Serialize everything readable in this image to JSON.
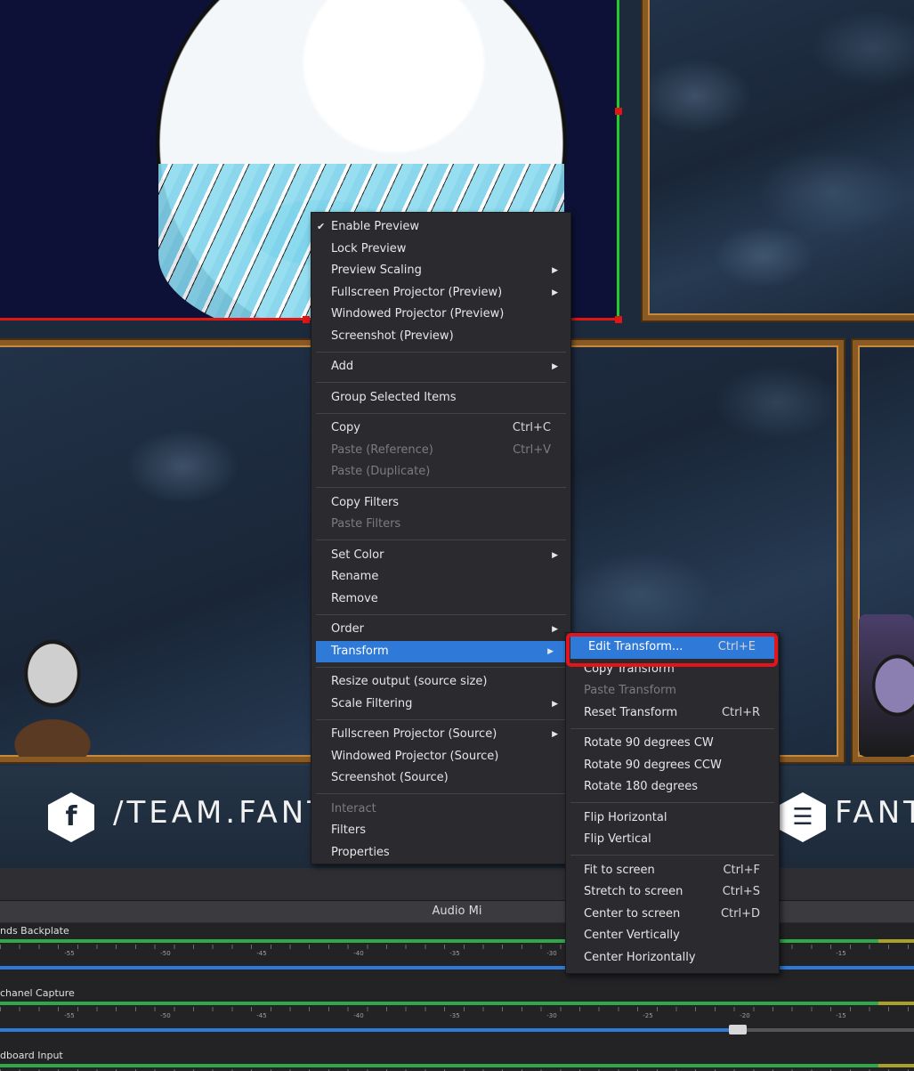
{
  "canvas": {
    "banner_left_text": "/TEAM.FANTA",
    "banner_right_text": "FANTA",
    "facebook_glyph": "f"
  },
  "context_menu": {
    "items": [
      {
        "label": "Enable Preview",
        "checked": true
      },
      {
        "label": "Lock Preview"
      },
      {
        "label": "Preview Scaling",
        "submenu": true
      },
      {
        "label": "Fullscreen Projector (Preview)",
        "submenu": true
      },
      {
        "label": "Windowed Projector (Preview)"
      },
      {
        "label": "Screenshot (Preview)"
      },
      {
        "label": "Add",
        "submenu": true
      },
      {
        "label": "Group Selected Items"
      },
      {
        "label": "Copy",
        "shortcut": "Ctrl+C"
      },
      {
        "label": "Paste (Reference)",
        "shortcut": "Ctrl+V",
        "disabled": true
      },
      {
        "label": "Paste (Duplicate)",
        "disabled": true
      },
      {
        "label": "Copy Filters"
      },
      {
        "label": "Paste Filters",
        "disabled": true
      },
      {
        "label": "Set Color",
        "submenu": true
      },
      {
        "label": "Rename"
      },
      {
        "label": "Remove"
      },
      {
        "label": "Order",
        "submenu": true
      },
      {
        "label": "Transform",
        "submenu": true,
        "active": true
      },
      {
        "label": "Resize output (source size)"
      },
      {
        "label": "Scale Filtering",
        "submenu": true
      },
      {
        "label": "Fullscreen Projector (Source)",
        "submenu": true
      },
      {
        "label": "Windowed Projector (Source)"
      },
      {
        "label": "Screenshot (Source)"
      },
      {
        "label": "Interact",
        "disabled": true
      },
      {
        "label": "Filters"
      },
      {
        "label": "Properties"
      }
    ]
  },
  "transform_submenu": {
    "items": [
      {
        "label": "Edit Transform...",
        "shortcut": "Ctrl+E",
        "active": true
      },
      {
        "label": "Copy Transform"
      },
      {
        "label": "Paste Transform",
        "disabled": true
      },
      {
        "label": "Reset Transform",
        "shortcut": "Ctrl+R"
      },
      {
        "label": "Rotate 90 degrees CW"
      },
      {
        "label": "Rotate 90 degrees CCW"
      },
      {
        "label": "Rotate 180 degrees"
      },
      {
        "label": "Flip Horizontal"
      },
      {
        "label": "Flip Vertical"
      },
      {
        "label": "Fit to screen",
        "shortcut": "Ctrl+F"
      },
      {
        "label": "Stretch to screen",
        "shortcut": "Ctrl+S"
      },
      {
        "label": "Center to screen",
        "shortcut": "Ctrl+D"
      },
      {
        "label": "Center Vertically"
      },
      {
        "label": "Center Horizontally"
      }
    ]
  },
  "audio_mixer": {
    "title": "Audio Mi",
    "channels": [
      {
        "name": "nds Backplate",
        "volume": 1.0
      },
      {
        "name": "chanel Capture",
        "volume": 0.8
      },
      {
        "name": "dboard Input",
        "volume": null
      }
    ],
    "tick_labels": [
      "-55",
      "-50",
      "-45",
      "-40",
      "-35",
      "-30",
      "-25",
      "-20",
      "-15"
    ]
  },
  "colors": {
    "menu_bg": "#2b2b2f",
    "menu_highlight": "#2f7ad8",
    "annotation_ring": "#e3141c",
    "selection_red": "#e01515",
    "selection_green": "#1ecf2c"
  }
}
